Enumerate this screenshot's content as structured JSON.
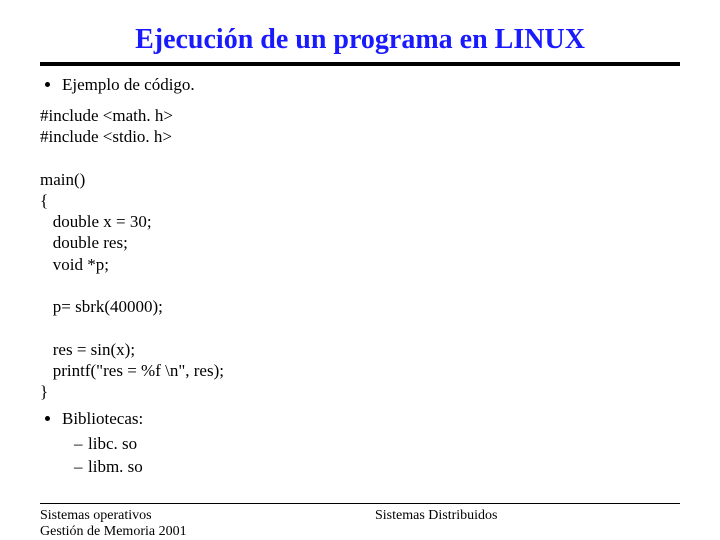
{
  "title": "Ejecución de un programa en LINUX",
  "bullet1": "Ejemplo de código.",
  "code": "#include <math. h>\n#include <stdio. h>\n\nmain()\n{\n   double x = 30;\n   double res;\n   void *p;\n\n   p= sbrk(40000);\n\n   res = sin(x);\n   printf(\"res = %f \\n\", res);\n}",
  "bib_label": "Bibliotecas:",
  "bib_items": [
    "libc. so",
    "libm. so"
  ],
  "footer": {
    "left1": "Sistemas operativos",
    "left2": "Gestión de Memoria 2001",
    "right": "Sistemas Distribuidos"
  }
}
